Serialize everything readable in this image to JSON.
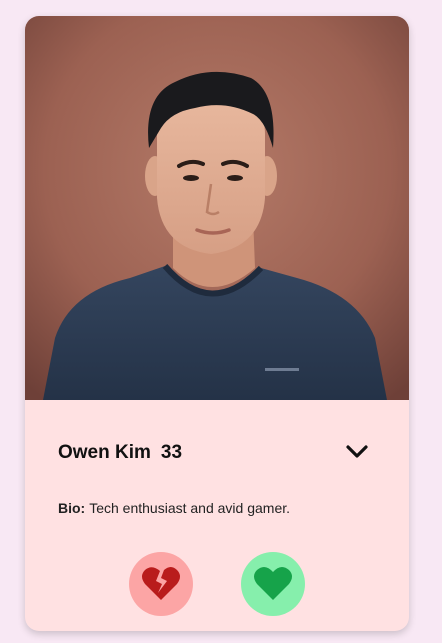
{
  "profile": {
    "name": "Owen Kim",
    "age": "33",
    "bio_label": "Bio:",
    "bio_text": "Tech enthusiast and avid gamer.",
    "photo_alt": "Owen Kim"
  },
  "icons": {
    "expand": "chevron-down-icon",
    "dislike": "broken-heart-icon",
    "like": "heart-icon"
  },
  "colors": {
    "background": "#f8e8f4",
    "card": "#ffe1e2",
    "dislike_button": "#fca5a5",
    "dislike_icon": "#b91c1c",
    "like_button": "#86efac",
    "like_icon": "#16a34a"
  }
}
